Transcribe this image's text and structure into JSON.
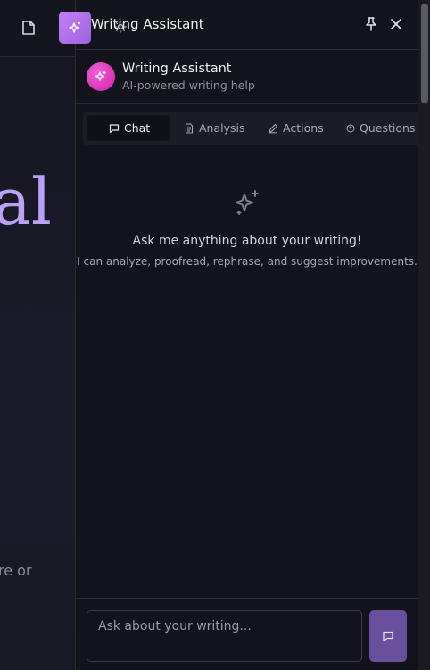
{
  "background": {
    "glyph": "al",
    "text_fragment": "re or"
  },
  "panel": {
    "title": "Writing Assistant",
    "assistant_name": "Writing Assistant",
    "assistant_subtitle": "AI-powered writing help"
  },
  "tabs": [
    {
      "label": "Chat",
      "icon": "chat-icon",
      "active": true
    },
    {
      "label": "Analysis",
      "icon": "document-icon",
      "active": false
    },
    {
      "label": "Actions",
      "icon": "pencil-icon",
      "active": false
    },
    {
      "label": "Questions",
      "icon": "question-icon",
      "active": false
    }
  ],
  "empty_state": {
    "title": "Ask me anything about your writing!",
    "subtitle": "I can analyze, proofread, rephrase, and suggest improvements."
  },
  "composer": {
    "placeholder": "Ask about your writing...",
    "value": ""
  },
  "colors": {
    "accent": "#6a4f9e",
    "avatar": "#e23bbd",
    "launcher": "#b374ee"
  }
}
